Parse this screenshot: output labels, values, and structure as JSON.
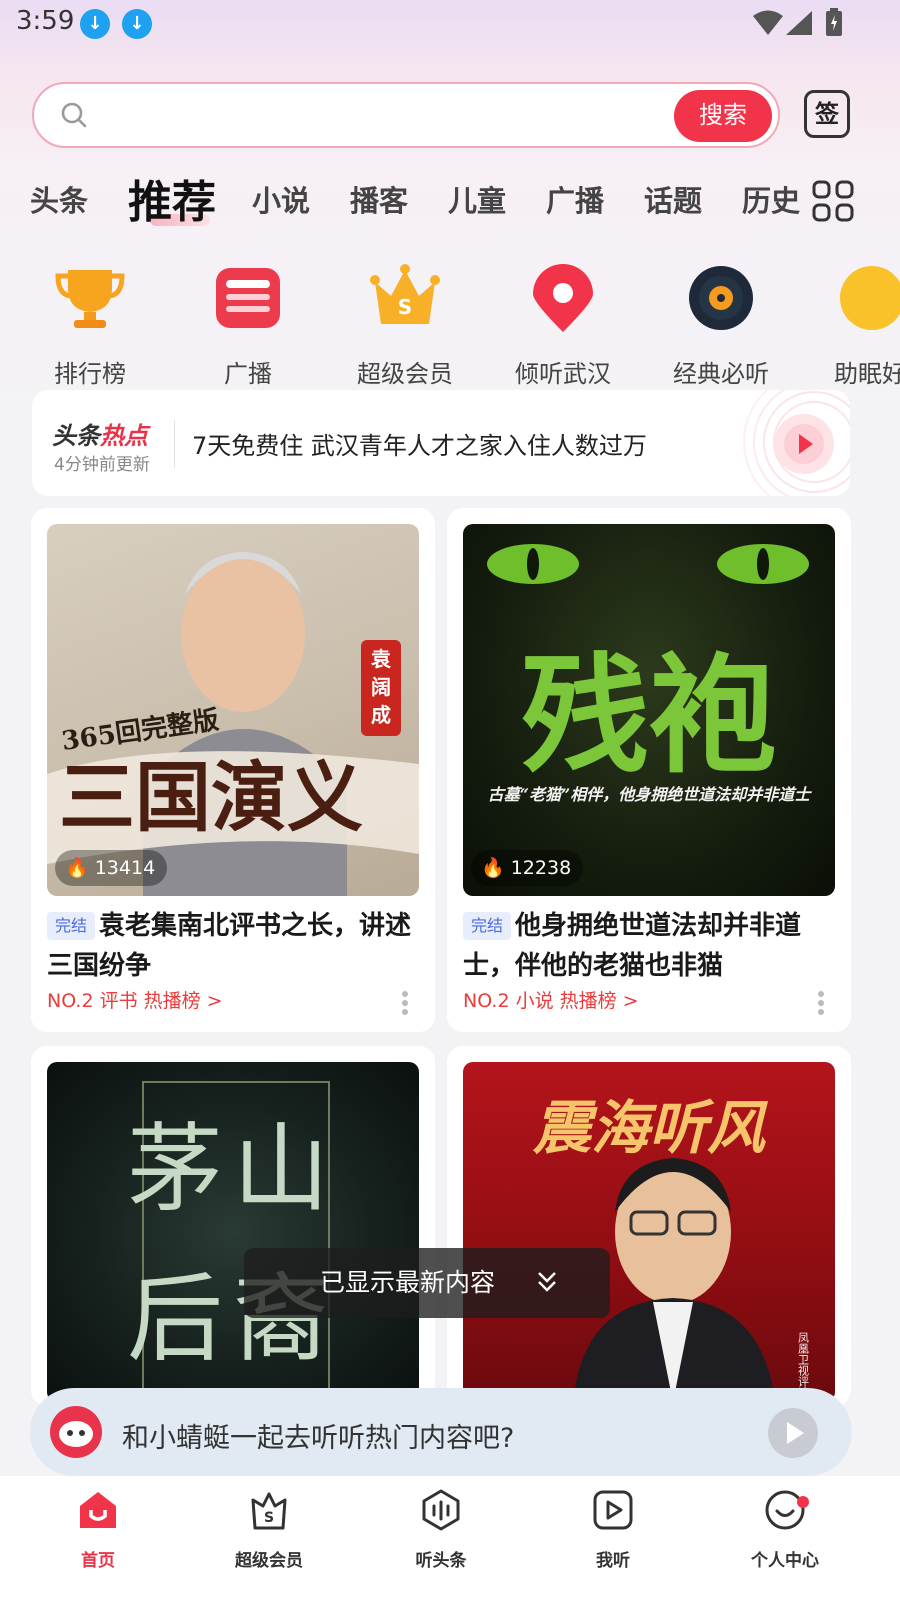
{
  "status_bar": {
    "time": "3:59"
  },
  "search": {
    "placeholder": "",
    "button_label": "搜索",
    "sign_label": "签"
  },
  "tabs": [
    {
      "label": "头条"
    },
    {
      "label": "推荐"
    },
    {
      "label": "小说"
    },
    {
      "label": "播客"
    },
    {
      "label": "儿童"
    },
    {
      "label": "广播"
    },
    {
      "label": "话题"
    },
    {
      "label": "历史"
    }
  ],
  "categories": [
    {
      "label": "排行榜",
      "icon": "trophy-icon"
    },
    {
      "label": "广播",
      "icon": "radio-icon"
    },
    {
      "label": "超级会员",
      "icon": "crown-icon"
    },
    {
      "label": "倾听武汉",
      "icon": "location-pin-icon"
    },
    {
      "label": "经典必听",
      "icon": "vinyl-record-icon"
    },
    {
      "label": "助眠好",
      "icon": "moon-icon"
    }
  ],
  "hot": {
    "brand_a": "头条",
    "brand_b": "热点",
    "update": "4分钟前更新",
    "headline": "7天免费住 武汉青年人才之家入住人数过万"
  },
  "cards": [
    {
      "cover_text": "三国演义",
      "cover_sub": "365回完整版",
      "cover_author": "袁阔成",
      "plays": "13414",
      "badge": "完结",
      "title": "袁老集南北评书之长，讲述三国纷争",
      "rank": "NO.2 评书 热播榜 >"
    },
    {
      "cover_text": "残袍",
      "cover_sub": "古墓“老猫”相伴，他身拥绝世道法却并非道士",
      "plays": "12238",
      "badge": "完结",
      "title": "他身拥绝世道法却并非道士，伴他的老猫也非猫",
      "rank": "NO.2 小说 热播榜 >"
    },
    {
      "cover_text": "茅山后裔"
    },
    {
      "cover_text": "震海听风",
      "cover_side": "凤凰卫视评论员 邱震海"
    }
  ],
  "toast": "已显示最新内容",
  "assistant": {
    "text": "和小蜻蜓一起去听听热门内容吧?"
  },
  "nav": [
    {
      "label": "首页",
      "icon": "home-icon"
    },
    {
      "label": "超级会员",
      "icon": "vip-bag-icon"
    },
    {
      "label": "听头条",
      "icon": "sound-wave-icon"
    },
    {
      "label": "我听",
      "icon": "play-square-icon"
    },
    {
      "label": "个人中心",
      "icon": "smile-face-icon"
    }
  ],
  "colors": {
    "accent": "#f2344a",
    "rank": "#ec3b3b",
    "badge": "#4a6be0"
  }
}
